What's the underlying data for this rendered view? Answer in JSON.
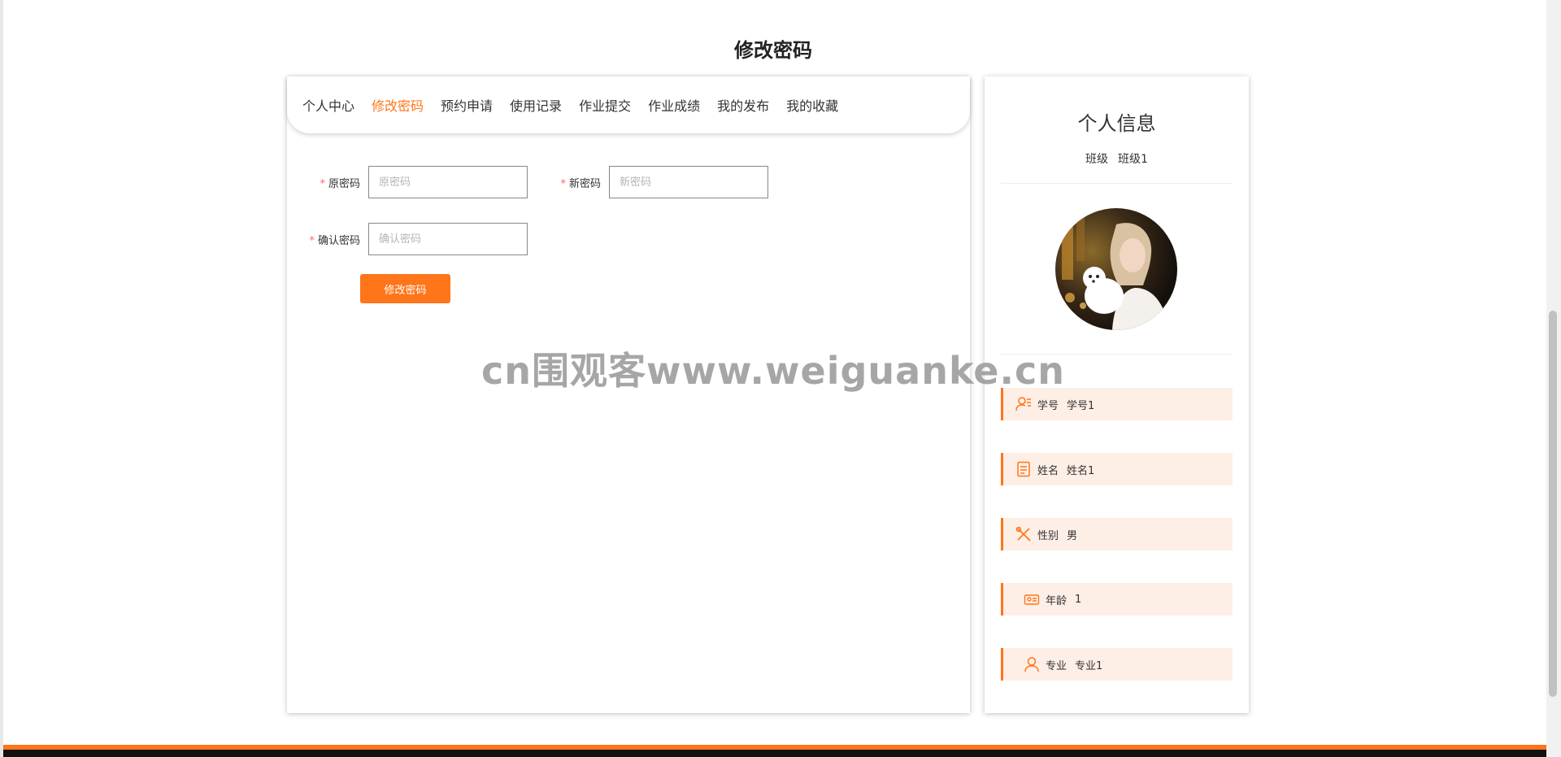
{
  "page": {
    "title": "修改密码"
  },
  "tabs": [
    {
      "label": "个人中心",
      "active": false
    },
    {
      "label": "修改密码",
      "active": true
    },
    {
      "label": "预约申请",
      "active": false
    },
    {
      "label": "使用记录",
      "active": false
    },
    {
      "label": "作业提交",
      "active": false
    },
    {
      "label": "作业成绩",
      "active": false
    },
    {
      "label": "我的发布",
      "active": false
    },
    {
      "label": "我的收藏",
      "active": false
    }
  ],
  "form": {
    "old_password": {
      "label": "原密码",
      "placeholder": "原密码",
      "value": ""
    },
    "new_password": {
      "label": "新密码",
      "placeholder": "新密码",
      "value": ""
    },
    "confirm_password": {
      "label": "确认密码",
      "placeholder": "确认密码",
      "value": ""
    },
    "required_mark": "*",
    "submit_label": "修改密码"
  },
  "profile": {
    "title": "个人信息",
    "class_label": "班级",
    "class_value": "班级1",
    "items": [
      {
        "icon": "user-id-icon",
        "label": "学号",
        "value": "学号1"
      },
      {
        "icon": "document-icon",
        "label": "姓名",
        "value": "姓名1"
      },
      {
        "icon": "tools-icon",
        "label": "性别",
        "value": "男"
      },
      {
        "icon": "id-card-icon",
        "label": "年龄",
        "value": "1"
      },
      {
        "icon": "person-icon",
        "label": "专业",
        "value": "专业1"
      }
    ]
  },
  "watermark": "cn围观客www.weiguanke.cn",
  "colors": {
    "accent": "#ff7519",
    "info_bg": "#fdeee6",
    "required": "#f56c6c",
    "footer": "#111111"
  }
}
